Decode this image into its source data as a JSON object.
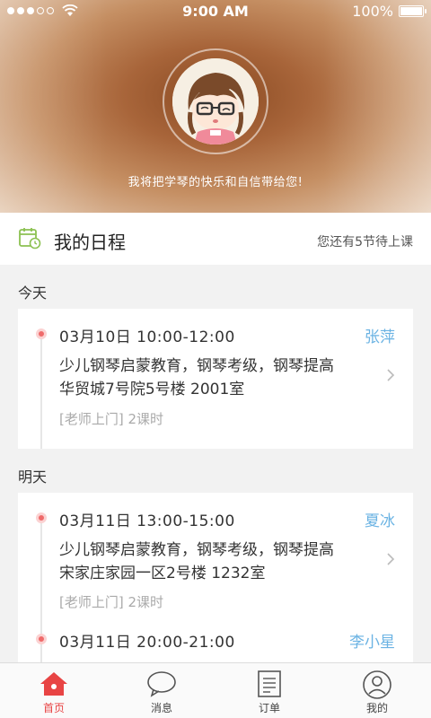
{
  "status_bar": {
    "time": "9:00 AM",
    "battery": "100%"
  },
  "hero": {
    "slogan": "我将把学琴的快乐和自信带给您!"
  },
  "schedule": {
    "title": "我的日程",
    "remaining": "您还有5节待上课"
  },
  "days": [
    {
      "label": "今天"
    },
    {
      "label": "明天"
    }
  ],
  "lessons": [
    {
      "time": "03月10日   10:00-12:00",
      "teacher": "张萍",
      "line1": "少儿钢琴启蒙教育，钢琴考级，钢琴提高",
      "line2": "华贸城7号院5号楼  2001室",
      "tags": "[老师上门]  2课时"
    },
    {
      "time": "03月11日   13:00-15:00",
      "teacher": "夏冰",
      "line1": "少儿钢琴启蒙教育，钢琴考级，钢琴提高",
      "line2": "宋家庄家园一区2号楼  1232室",
      "tags": "[老师上门]  2课时"
    },
    {
      "time": "03月11日   20:00-21:00",
      "teacher": "李小星"
    }
  ],
  "tabs": [
    {
      "label": "首页",
      "icon": "home-icon"
    },
    {
      "label": "消息",
      "icon": "chat-icon"
    },
    {
      "label": "订单",
      "icon": "document-icon"
    },
    {
      "label": "我的",
      "icon": "user-icon"
    }
  ],
  "colors": {
    "accent": "#e84444",
    "teacher": "#6bb3e3",
    "calendar": "#8cc152"
  }
}
